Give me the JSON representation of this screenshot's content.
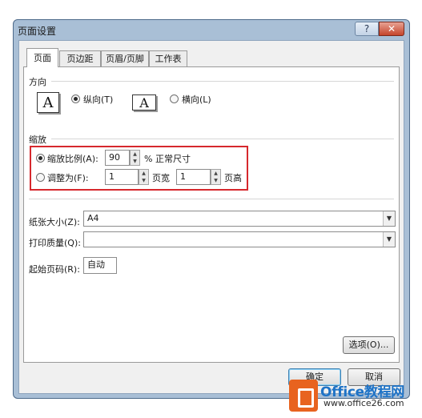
{
  "window": {
    "title": "页面设置",
    "help": "?",
    "close": "✕"
  },
  "tabs": [
    "页面",
    "页边距",
    "页眉/页脚",
    "工作表"
  ],
  "orientation": {
    "label": "方向",
    "portrait": {
      "icon_letter": "A",
      "label": "纵向(T)",
      "selected": true
    },
    "landscape": {
      "icon_letter": "A",
      "label": "横向(L)",
      "selected": false
    }
  },
  "scaling": {
    "label": "缩放",
    "adjust": {
      "label": "缩放比例(A):",
      "value": "90",
      "suffix": "% 正常尺寸",
      "selected": true
    },
    "fit": {
      "label": "调整为(F):",
      "width_value": "1",
      "width_unit": "页宽",
      "height_value": "1",
      "height_unit": "页高",
      "selected": false
    }
  },
  "paper_size": {
    "label": "纸张大小(Z):",
    "value": "A4"
  },
  "print_quality": {
    "label": "打印质量(Q):",
    "value": ""
  },
  "first_page": {
    "label": "起始页码(R):",
    "value": "自动"
  },
  "buttons": {
    "options": "选项(O)...",
    "ok": "确定",
    "cancel": "取消"
  },
  "watermark": {
    "brand": "Office教程网",
    "url": "www.office26.com"
  },
  "colors": {
    "highlight": "#d6282d",
    "logo_orange": "#e8631f",
    "logo_blue": "#1e73c7"
  }
}
